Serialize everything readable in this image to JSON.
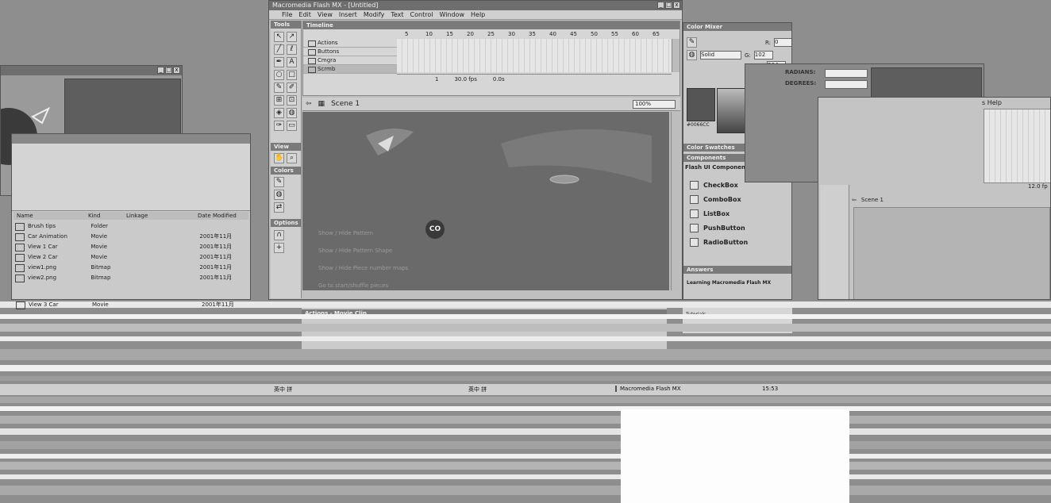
{
  "flash_window": {
    "title": "Macromedia Flash MX - [Untitled]",
    "menu": [
      "File",
      "Edit",
      "View",
      "Insert",
      "Modify",
      "Text",
      "Control",
      "Window",
      "Help"
    ]
  },
  "tools": {
    "header": "Tools",
    "view_label": "View",
    "colors_label": "Colors",
    "options_label": "Options"
  },
  "timeline": {
    "header": "Timeline",
    "frame_numbers": [
      "5",
      "10",
      "15",
      "20",
      "25",
      "30",
      "35",
      "40",
      "45",
      "50",
      "55",
      "60",
      "65"
    ],
    "layers": [
      "Actions",
      "Buttons",
      "Cmgra",
      "Scrmb"
    ],
    "current_frame": "1",
    "fps": "30.0 fps",
    "elapsed": "0.0s"
  },
  "stage": {
    "scene_label": "Scene 1",
    "zoom": "100%",
    "menu_lines": [
      "Show / Hide Pattern",
      "Show / Hide Pattern Shape",
      "Show / Hide Piece number maps",
      "Go to start/shuffle pieces"
    ],
    "badge": "CO"
  },
  "actions_panel": {
    "header": "Actions - Movie Clip"
  },
  "color_mixer": {
    "header": "Color Mixer",
    "fill_type": "Solid",
    "r": "0",
    "g": "102",
    "b": "204",
    "hex": "#0066CC",
    "swatches_header": "Color Swatches"
  },
  "components": {
    "header": "Components",
    "subheader": "Flash UI Components",
    "items": [
      "CheckBox",
      "ComboBox",
      "ListBox",
      "PushButton",
      "RadioButton"
    ]
  },
  "answers": {
    "header": "Answers",
    "title": "Learning Macromedia Flash MX",
    "links": [
      "What's new",
      "Tutorials"
    ]
  },
  "dialog": {
    "radians_label": "RADIANS:",
    "degrees_label": "DEGREES:"
  },
  "library": {
    "columns": [
      "Name",
      "Kind",
      "Linkage",
      "Date Modified"
    ],
    "rows": [
      {
        "name": "Brush tips",
        "kind": "Folder",
        "date": ""
      },
      {
        "name": "Car Animation",
        "kind": "Movie",
        "date": "2001年11月"
      },
      {
        "name": "View 1 Car",
        "kind": "Movie",
        "date": "2001年11月"
      },
      {
        "name": "View 2 Car",
        "kind": "Movie",
        "date": "2001年11月"
      },
      {
        "name": "view1.png",
        "kind": "Bitmap",
        "date": "2001年11月"
      },
      {
        "name": "view2.png",
        "kind": "Bitmap",
        "date": "2001年11月"
      },
      {
        "name": "View 3 Car",
        "kind": "Movie",
        "date": "2001年11月"
      }
    ]
  },
  "right_window": {
    "menu_fragment": "s  Help",
    "scene_label": "Scene 1",
    "fps_fragment": "12.0 fp"
  },
  "taskbar": {
    "ime_left": "英中 拼 ",
    "ime_mid": "英中 拼 ",
    "app_button": "Macromedia Flash MX",
    "clock": "15:53"
  }
}
